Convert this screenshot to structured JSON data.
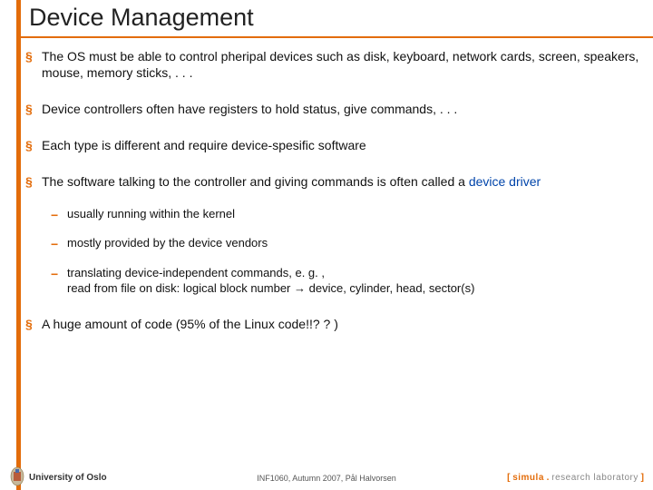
{
  "title": "Device Management",
  "bullets": {
    "b0": {
      "pre": "The OS must be able to control pheripal devices such as disk, keyboard, network cards, screen, speakers, mouse, memory sticks, . . ."
    },
    "b1": {
      "pre": "Device controllers often have registers to hold status, give commands, . . ."
    },
    "b2": {
      "pre": "Each type is different and require device-spesific software"
    },
    "b3": {
      "pre": "The software talking to the controller and giving commands is often called a ",
      "em": "device driver",
      "sub": {
        "s0": "usually running within the kernel",
        "s1": "mostly provided by the device vendors",
        "s2": "translating device-independent commands, e. g. ,\nread from file on disk: logical block number → device, cylinder, head, sector(s)"
      }
    },
    "b4": {
      "pre": "A huge amount of code (95% of the Linux code!!? ? )"
    }
  },
  "footer": {
    "left": "University of Oslo",
    "center": "INF1060, Autumn 2007, Pål Halvorsen",
    "right": {
      "open": "[ ",
      "brand": "simula",
      "dot": " . ",
      "rest": "research laboratory",
      "close": " ]"
    }
  }
}
